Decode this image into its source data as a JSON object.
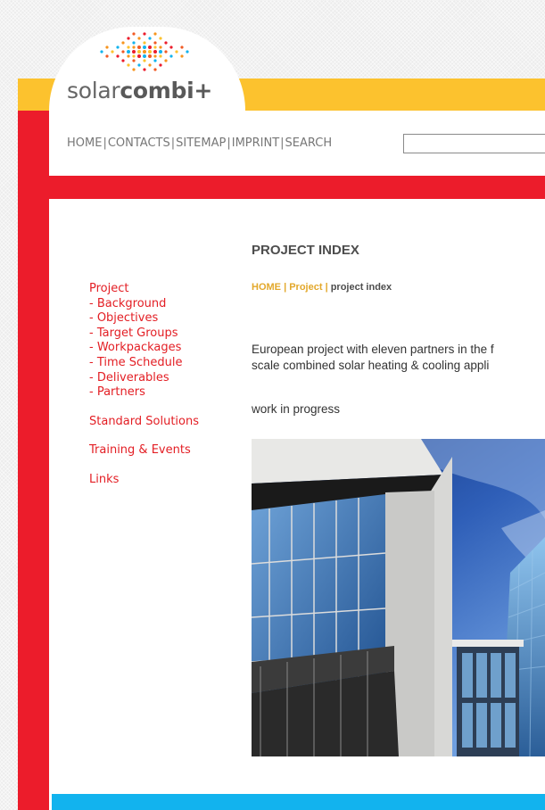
{
  "logo": {
    "text_light": "solar",
    "text_bold": "combi+"
  },
  "topnav": {
    "items": [
      "HOME",
      "CONTACTS",
      "SITEMAP",
      "IMPRINT",
      "SEARCH"
    ],
    "separator": "|"
  },
  "search": {
    "value": ""
  },
  "sidebar": {
    "project_label": "Project",
    "sub_items": [
      "- Background",
      "- Objectives",
      "- Target Groups",
      "- Workpackages",
      "- Time Schedule",
      "- Deliverables",
      "- Partners"
    ],
    "standard_solutions": "Standard Solutions",
    "training_events": "Training & Events",
    "links": "Links"
  },
  "main": {
    "title": "PROJECT INDEX",
    "breadcrumb": {
      "home": "HOME",
      "project": "Project",
      "current": "project index",
      "separator": "|"
    },
    "intro_line1": "European project with eleven partners in the f",
    "intro_line2": "scale combined solar heating & cooling appli",
    "status": "work in progress"
  },
  "colors": {
    "red": "#ec1c2b",
    "yellow": "#fcc22e",
    "blue": "#12b3ee",
    "link_red": "#e31e24",
    "breadcrumb_gold": "#e3a82b"
  }
}
